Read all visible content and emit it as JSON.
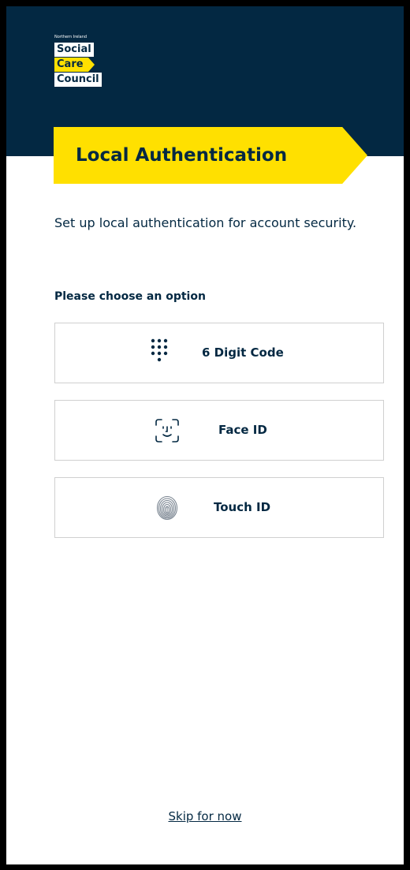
{
  "brand": {
    "tagline": "Northern Ireland",
    "line1": "Social",
    "line2": "Care",
    "line3": "Council"
  },
  "page": {
    "title": "Local Authentication",
    "intro": "Set up local authentication for account security.",
    "choose_label": "Please choose an option"
  },
  "options": [
    {
      "label": "6 Digit Code",
      "icon": "keypad-icon"
    },
    {
      "label": "Face ID",
      "icon": "face-id-icon"
    },
    {
      "label": "Touch ID",
      "icon": "fingerprint-icon"
    }
  ],
  "footer": {
    "skip_label": "Skip for now"
  },
  "colors": {
    "navy": "#032842",
    "yellow": "#ffe000",
    "border": "#d0d0d0"
  }
}
